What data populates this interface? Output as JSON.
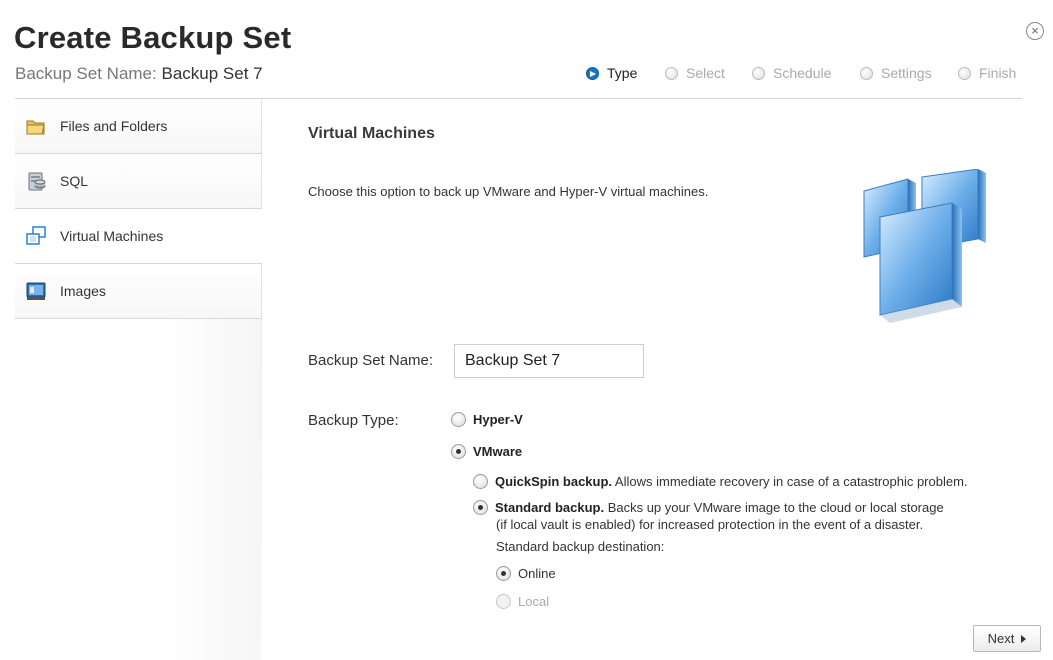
{
  "header": {
    "title": "Create Backup Set",
    "subtitle_label": "Backup Set Name:",
    "subtitle_value": "Backup Set 7"
  },
  "steps": [
    {
      "label": "Type",
      "active": true
    },
    {
      "label": "Select",
      "active": false
    },
    {
      "label": "Schedule",
      "active": false
    },
    {
      "label": "Settings",
      "active": false
    },
    {
      "label": "Finish",
      "active": false
    }
  ],
  "sidebar": {
    "items": [
      {
        "label": "Files and Folders",
        "icon": "folder-icon"
      },
      {
        "label": "SQL",
        "icon": "sql-server-icon"
      },
      {
        "label": "Virtual Machines",
        "icon": "virtual-machines-icon",
        "selected": true
      },
      {
        "label": "Images",
        "icon": "disk-image-icon"
      }
    ]
  },
  "main": {
    "heading": "Virtual Machines",
    "description": "Choose this option to back up VMware and Hyper-V virtual machines.",
    "name_label": "Backup Set Name:",
    "name_value": "Backup Set 7",
    "type_label": "Backup Type:",
    "options": {
      "hyperv": {
        "label": "Hyper-V",
        "checked": false
      },
      "vmware": {
        "label": "VMware",
        "checked": true
      },
      "quickspin": {
        "title": "QuickSpin backup.",
        "text": " Allows immediate recovery in case of a catastrophic problem.",
        "checked": false
      },
      "standard": {
        "title": "Standard backup.",
        "text": " Backs up your VMware image to the cloud or local storage",
        "checked": true
      },
      "standard_note": "(if local vault is enabled) for increased protection in the event of a disaster.",
      "destination_label": "Standard backup destination:",
      "online": {
        "label": "Online",
        "checked": true
      },
      "local": {
        "label": "Local",
        "checked": false,
        "disabled": true
      }
    }
  },
  "footer": {
    "next_label": "Next"
  },
  "colors": {
    "accent": "#1873c9",
    "rule": "#d4d4d4"
  }
}
